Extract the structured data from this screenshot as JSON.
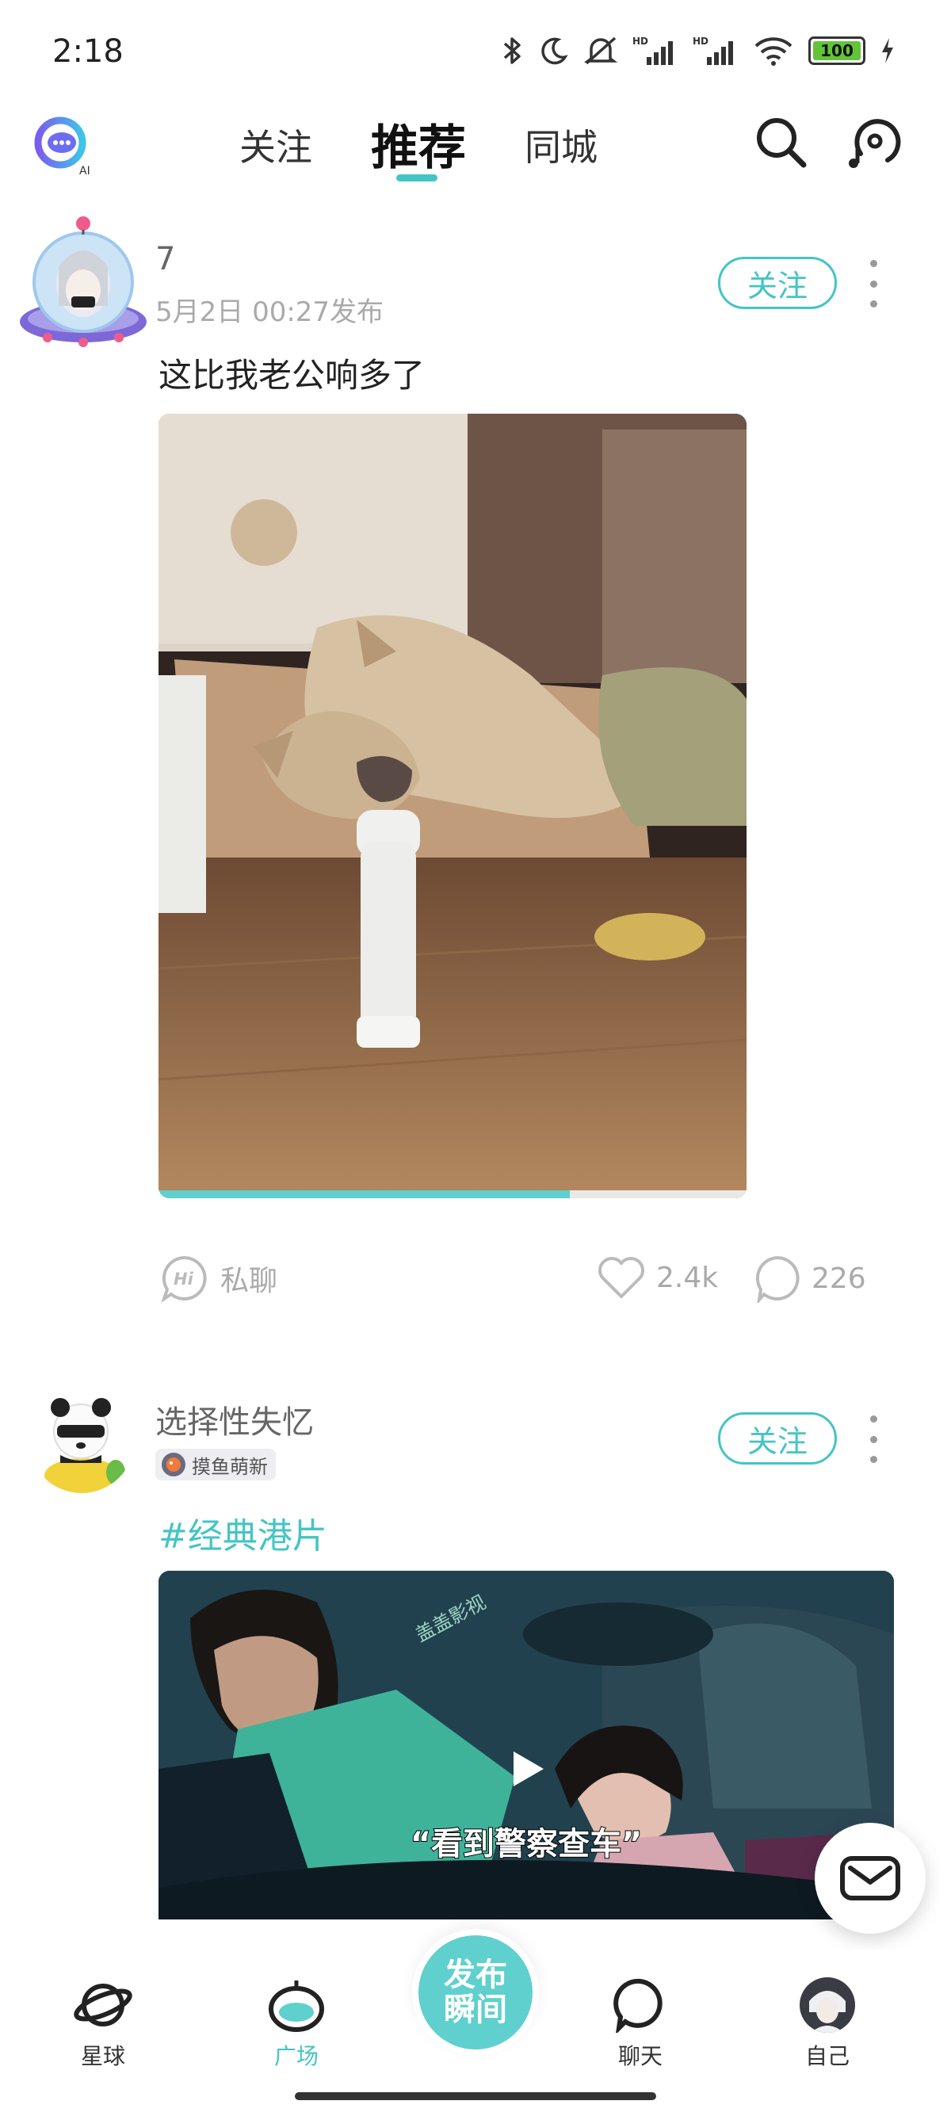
{
  "status_bar": {
    "time": "2:18",
    "battery": "100",
    "icons": [
      "bluetooth-icon",
      "moon-icon",
      "silent-icon",
      "hd-signal-icon",
      "hd-signal-icon",
      "wifi-icon",
      "battery-icon",
      "charging-icon"
    ]
  },
  "top_nav": {
    "tabs": [
      {
        "label": "关注"
      },
      {
        "label": "推荐"
      },
      {
        "label": "同城"
      }
    ],
    "active_tab": "推荐",
    "accent_color": "#45c4c4"
  },
  "posts": [
    {
      "username": "7",
      "timestamp": "5月2日 00:27发布",
      "follow_label": "关注",
      "text": "这比我老公响多了",
      "video_progress": 0.7,
      "actions": {
        "chat_label": "私聊",
        "likes": "2.4k",
        "comments": "226"
      }
    },
    {
      "username": "选择性失忆",
      "badge": "摸鱼萌新",
      "follow_label": "关注",
      "hashtag": "#经典港片",
      "video_caption": "“看到警察查车”",
      "watermark": "盖盖影视"
    }
  ],
  "bottom_nav": {
    "items": [
      {
        "label": "星球"
      },
      {
        "label": "广场"
      },
      {
        "label": "聊天"
      },
      {
        "label": "自己"
      }
    ],
    "active_item": "广场",
    "publish_label_line1": "发布",
    "publish_label_line2": "瞬间"
  }
}
